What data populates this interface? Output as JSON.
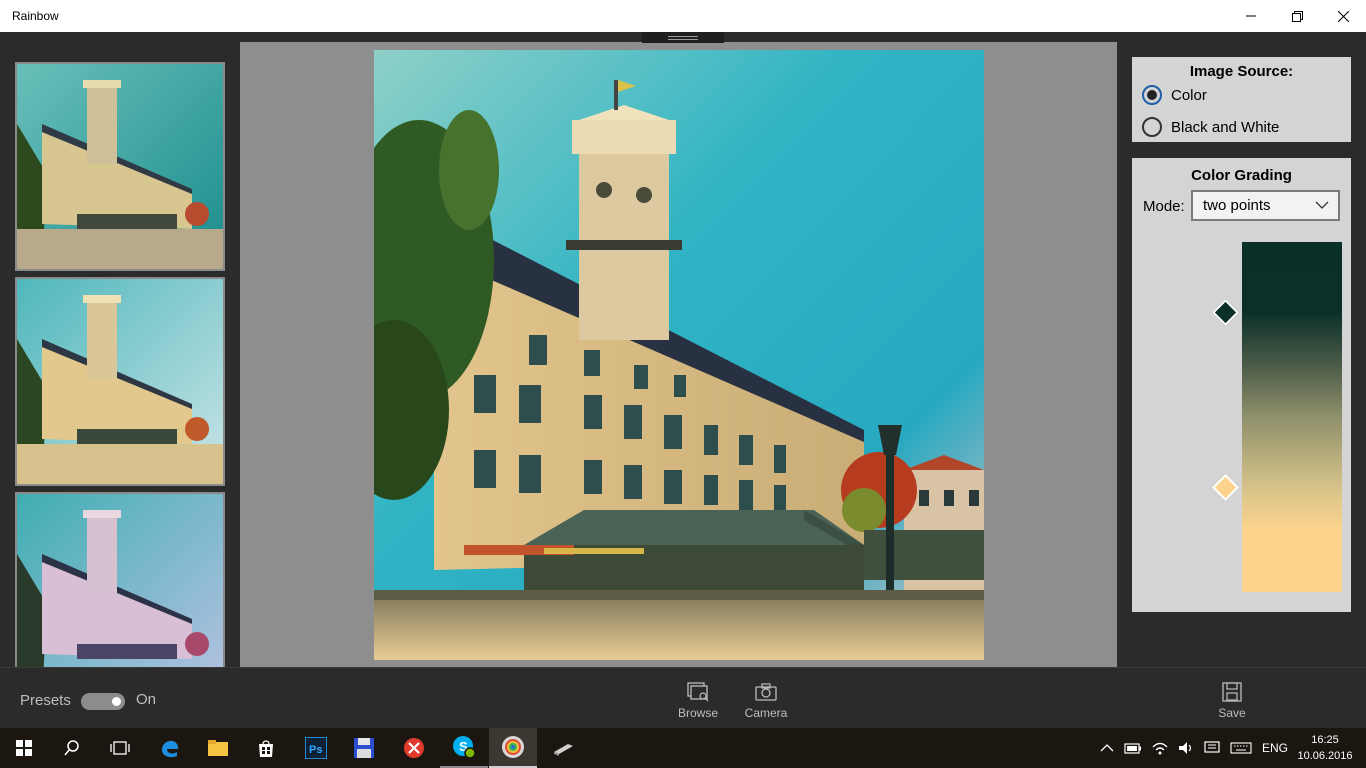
{
  "window": {
    "title": "Rainbow"
  },
  "source": {
    "title": "Image Source:",
    "options": [
      {
        "label": "Color",
        "selected": true
      },
      {
        "label": "Black and White",
        "selected": false
      }
    ]
  },
  "grading": {
    "title": "Color Grading",
    "mode_label": "Mode:",
    "mode_value": "two points",
    "points": [
      {
        "color": "#0b3029"
      },
      {
        "color": "#fbd38c"
      }
    ]
  },
  "appbar": {
    "presets_label": "Presets",
    "toggle_state": "On",
    "browse_label": "Browse",
    "camera_label": "Camera",
    "save_label": "Save"
  },
  "taskbar": {
    "language": "ENG",
    "time": "16:25",
    "date": "10.06.2016"
  },
  "colors": {
    "app_bg": "#2b2b2b",
    "canvas_bg": "#8e8e8e",
    "panel_card": "#d4d4d4",
    "accent": "#1f5fa8"
  }
}
